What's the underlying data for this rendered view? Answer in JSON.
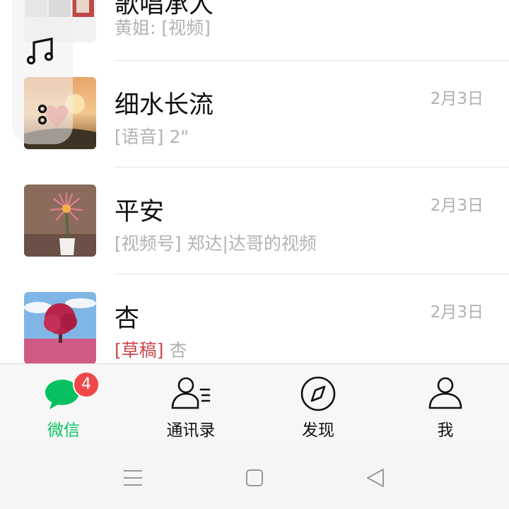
{
  "chats": [
    {
      "name": "歌唱承人",
      "preview": "黄姐: [视频]",
      "time": ""
    },
    {
      "name": "细水长流",
      "preview": "[语音] 2\"",
      "time": "2月3日"
    },
    {
      "name": "平安",
      "preview": "[视频号] 郑达|达哥的视频",
      "time": "2月3日"
    },
    {
      "name": "杏",
      "draft_tag": "[草稿]",
      "preview": "杏",
      "time": "2月3日"
    }
  ],
  "floating_window": {
    "icons": [
      "music-note-icon",
      "voice-dots-icon"
    ]
  },
  "tabbar": {
    "tabs": [
      {
        "label": "微信",
        "icon": "chat-bubble-icon",
        "active": true,
        "badge": "4"
      },
      {
        "label": "通讯录",
        "icon": "contacts-icon",
        "active": false
      },
      {
        "label": "发现",
        "icon": "compass-icon",
        "active": false
      },
      {
        "label": "我",
        "icon": "person-icon",
        "active": false
      }
    ]
  },
  "navbar": {
    "buttons": [
      "menu-icon",
      "home-icon",
      "back-icon"
    ]
  },
  "colors": {
    "accent": "#07c160",
    "badge": "#f04848",
    "draft": "#c9464a",
    "secondary_text": "#b2b2b2"
  }
}
